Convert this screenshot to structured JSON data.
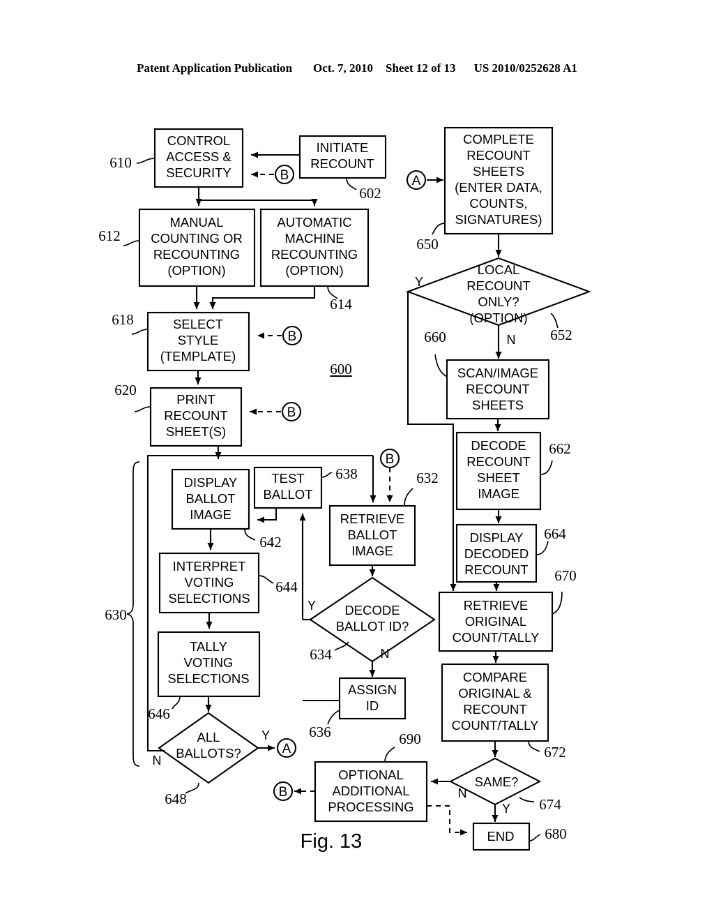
{
  "header": {
    "publication": "Patent Application Publication",
    "date": "Oct. 7, 2010",
    "sheet": "Sheet 12 of 13",
    "patent_number": "US 2010/0252628 A1"
  },
  "figure": {
    "label": "Fig. 13",
    "reference": "600"
  },
  "nodes": {
    "n602": {
      "text": [
        "INITIATE",
        "RECOUNT"
      ],
      "ref": "602",
      "shape": "process"
    },
    "n610": {
      "text": [
        "CONTROL",
        "ACCESS &",
        "SECURITY"
      ],
      "ref": "610",
      "shape": "process"
    },
    "n612": {
      "text": [
        "MANUAL",
        "COUNTING OR",
        "RECOUNTING",
        "(OPTION)"
      ],
      "ref": "612",
      "shape": "process"
    },
    "n614": {
      "text": [
        "AUTOMATIC",
        "MACHINE",
        "RECOUNTING",
        "(OPTION)"
      ],
      "ref": "614",
      "shape": "process"
    },
    "n618": {
      "text": [
        "SELECT",
        "STYLE",
        "(TEMPLATE)"
      ],
      "ref": "618",
      "shape": "process"
    },
    "n620": {
      "text": [
        "PRINT",
        "RECOUNT",
        "SHEET(S)"
      ],
      "ref": "620",
      "shape": "process"
    },
    "n630": {
      "text": [],
      "ref": "630",
      "shape": "group"
    },
    "n632": {
      "text": [
        "RETRIEVE",
        "BALLOT",
        "IMAGE"
      ],
      "ref": "632",
      "shape": "process"
    },
    "n634": {
      "text": [
        "DECODE",
        "BALLOT ID?"
      ],
      "ref": "634",
      "shape": "decision"
    },
    "n636": {
      "text": [
        "ASSIGN",
        "ID"
      ],
      "ref": "636",
      "shape": "process"
    },
    "n638": {
      "text": [
        "TEST",
        "BALLOT"
      ],
      "ref": "638",
      "shape": "process"
    },
    "n642": {
      "text": [
        "DISPLAY",
        "BALLOT",
        "IMAGE"
      ],
      "ref": "642",
      "shape": "process"
    },
    "n644": {
      "text": [
        "INTERPRET",
        "VOTING",
        "SELECTIONS"
      ],
      "ref": "644",
      "shape": "process"
    },
    "n646": {
      "text": [
        "TALLY",
        "VOTING",
        "SELECTIONS"
      ],
      "ref": "646",
      "shape": "process"
    },
    "n648": {
      "text": [
        "ALL",
        "BALLOTS?"
      ],
      "ref": "648",
      "shape": "decision"
    },
    "n650": {
      "text": [
        "COMPLETE",
        "RECOUNT",
        "SHEETS",
        "(ENTER DATA,",
        "COUNTS,",
        "SIGNATURES)"
      ],
      "ref": "650",
      "shape": "process"
    },
    "n652": {
      "text": [
        "LOCAL",
        "RECOUNT",
        "ONLY?",
        "(OPTION)"
      ],
      "ref": "652",
      "shape": "decision"
    },
    "n660": {
      "text": [
        "SCAN/IMAGE",
        "RECOUNT",
        "SHEETS"
      ],
      "ref": "660",
      "shape": "process"
    },
    "n662": {
      "text": [
        "DECODE",
        "RECOUNT",
        "SHEET",
        "IMAGE"
      ],
      "ref": "662",
      "shape": "process"
    },
    "n664": {
      "text": [
        "DISPLAY",
        "DECODED",
        "RECOUNT"
      ],
      "ref": "664",
      "shape": "process"
    },
    "n670": {
      "text": [
        "RETRIEVE",
        "ORIGINAL",
        "COUNT/TALLY"
      ],
      "ref": "670",
      "shape": "process"
    },
    "n672": {
      "text": [
        "COMPARE",
        "ORIGINAL &",
        "RECOUNT",
        "COUNT/TALLY"
      ],
      "ref": "672",
      "shape": "process"
    },
    "n674": {
      "text": [
        "SAME?"
      ],
      "ref": "674",
      "shape": "decision"
    },
    "n680": {
      "text": [
        "END"
      ],
      "ref": "680",
      "shape": "process"
    },
    "n690": {
      "text": [
        "OPTIONAL",
        "ADDITIONAL",
        "PROCESSING"
      ],
      "ref": "690",
      "shape": "process"
    }
  },
  "connectors": {
    "b1": "B",
    "b2": "B",
    "b3": "B",
    "b4": "B",
    "b5": "B",
    "a1": "A",
    "a2": "A"
  },
  "branch_labels": {
    "l652_y": "Y",
    "l652_n": "N",
    "l634_y": "Y",
    "l634_n": "N",
    "l648_y": "Y",
    "l648_n": "N",
    "l674_y": "Y",
    "l674_n": "N"
  }
}
